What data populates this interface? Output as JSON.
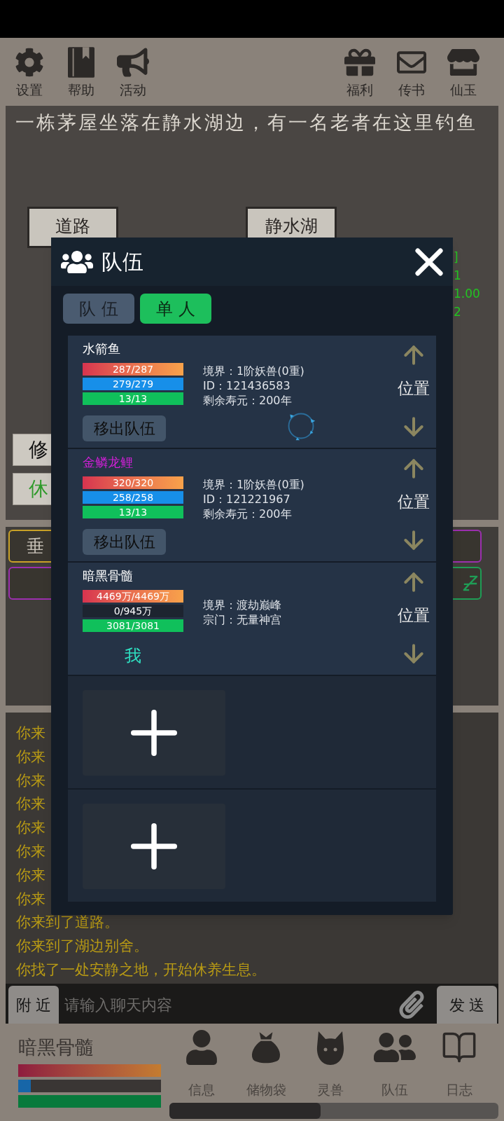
{
  "toolbar": {
    "left": [
      "设置",
      "帮助",
      "活动"
    ],
    "right": [
      "福利",
      "传书",
      "仙玉"
    ]
  },
  "scene": {
    "description": "一栋茅屋坐落在静水湖边，有一名老者在这里钓鱼",
    "locations": [
      "道路",
      "静水湖"
    ],
    "side_stats": [
      "]",
      "1",
      "1.00",
      "2"
    ],
    "actions": [
      {
        "label": "修",
        "color": "#111111"
      },
      {
        "label": "休",
        "color": "#2e9a2a"
      }
    ]
  },
  "activities": {
    "left": [
      {
        "kind": "label",
        "label": "垂",
        "color": "#c9a227"
      },
      {
        "kind": "blank",
        "color": "#9b2fae"
      }
    ],
    "right": [
      {
        "kind": "blank",
        "color": "#9b2fae"
      },
      {
        "kind": "sleep",
        "color": "#1f9d55"
      }
    ]
  },
  "log": {
    "lines": [
      "你来",
      "你来",
      "你来",
      "你来",
      "你来",
      "你来",
      "你来",
      "你来",
      "你来到了道路。",
      "你来到了湖边别舍。",
      "你找了一处安静之地，开始休养生息。"
    ]
  },
  "chat": {
    "channel": "附 近",
    "placeholder": "请输入聊天内容",
    "send": "发 送"
  },
  "player": {
    "name": "暗黑骨髓",
    "bars": [
      {
        "kind": "health",
        "level": 1
      },
      {
        "kind": "mana",
        "level": 0.09
      },
      {
        "kind": "stamina",
        "level": 1
      }
    ]
  },
  "nav": [
    "信息",
    "储物袋",
    "灵兽",
    "队伍",
    "日志"
  ],
  "modal": {
    "title": "队伍",
    "loading": true,
    "tabs": [
      {
        "label": "队 伍",
        "selected": false
      },
      {
        "label": "单 人",
        "selected": true
      }
    ],
    "slots": [
      {
        "kind": "member",
        "name": "水箭鱼",
        "color": "#ffffff",
        "bars": [
          {
            "kind": "health",
            "text": "287/287",
            "level": 1
          },
          {
            "kind": "mana",
            "text": "279/279",
            "level": 1
          },
          {
            "kind": "stamina",
            "text": "13/13",
            "level": 1
          }
        ],
        "info": [
          "境界：1阶妖兽(0重)",
          "ID：121436583",
          "剩余寿元：200年"
        ],
        "remove": "移出队伍",
        "position": "位置"
      },
      {
        "kind": "member",
        "name": "金鳞龙鲤",
        "color": "#d21fd8",
        "bars": [
          {
            "kind": "health",
            "text": "320/320",
            "level": 1
          },
          {
            "kind": "mana",
            "text": "258/258",
            "level": 1
          },
          {
            "kind": "stamina",
            "text": "13/13",
            "level": 1
          }
        ],
        "info": [
          "境界：1阶妖兽(0重)",
          "ID：121221967",
          "剩余寿元：200年"
        ],
        "remove": "移出队伍",
        "position": "位置"
      },
      {
        "kind": "self",
        "name": "暗黑骨髓",
        "color": "#ffffff",
        "bars": [
          {
            "kind": "health",
            "text": "4469万/4469万",
            "level": 1
          },
          {
            "kind": "mana",
            "text": "0/945万",
            "level": 0
          },
          {
            "kind": "stamina",
            "text": "3081/3081",
            "level": 1
          }
        ],
        "info": [
          "境界：渡劫巅峰",
          "宗门：无量神宫"
        ],
        "tag": "我",
        "position": "位置"
      },
      {
        "kind": "empty"
      },
      {
        "kind": "empty"
      }
    ]
  }
}
